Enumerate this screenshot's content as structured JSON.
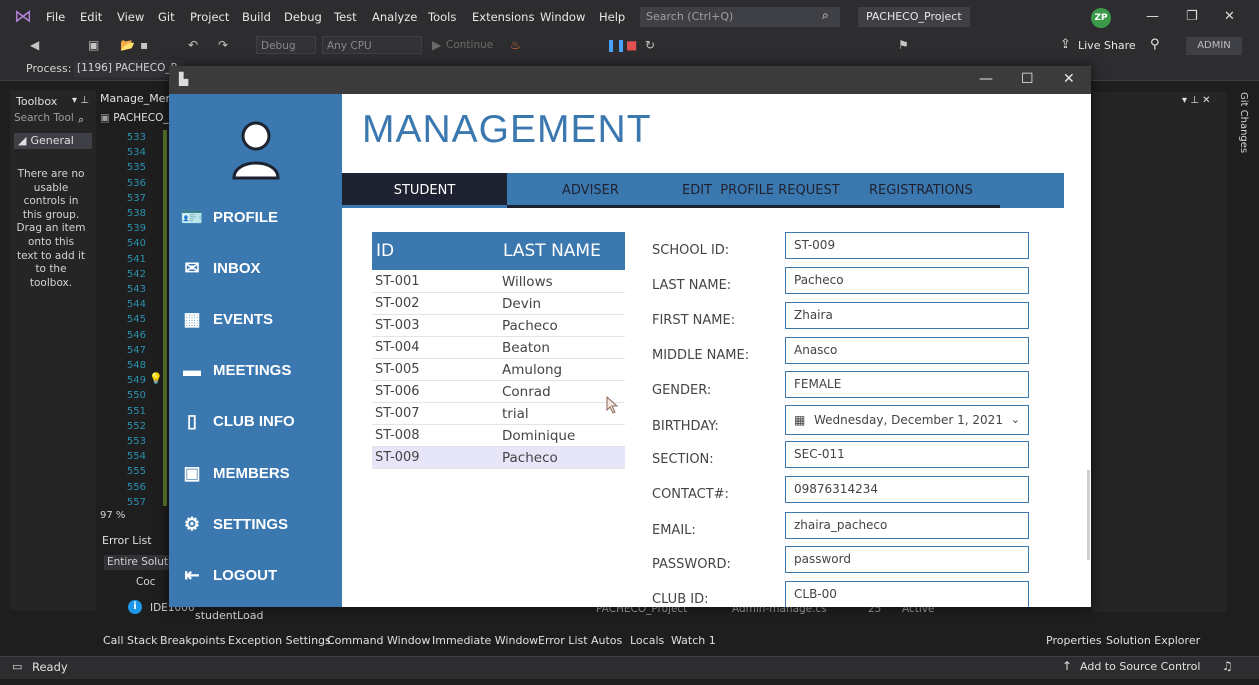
{
  "vs": {
    "menu": [
      "File",
      "Edit",
      "View",
      "Git",
      "Project",
      "Build",
      "Debug",
      "Test",
      "Analyze",
      "Tools",
      "Extensions",
      "Window",
      "Help"
    ],
    "search_placeholder": "Search (Ctrl+Q)",
    "project_name": "PACHECO_Project",
    "avatar_initials": "ZP",
    "toolbar": {
      "config": "Debug",
      "platform": "Any CPU",
      "continue": "Continue",
      "live_share": "Live Share",
      "admin": "ADMIN"
    },
    "process_label": "Process:",
    "process_value": "[1196] PACHECO_P",
    "toolbox": {
      "title": "Toolbox",
      "search_placeholder": "Search Tool",
      "group": "General",
      "empty_message": "There are no usable controls in this group. Drag an item onto this text to add it to the toolbox."
    },
    "editor_tab": "Manage_Men",
    "editor_subtab": "PACHECO_",
    "line_numbers": [
      "533",
      "534",
      "535",
      "536",
      "537",
      "538",
      "539",
      "540",
      "541",
      "542",
      "543",
      "544",
      "545",
      "546",
      "547",
      "548",
      "549",
      "550",
      "551",
      "552",
      "553",
      "554",
      "555",
      "556",
      "557"
    ],
    "zoom": "97 %",
    "error_list": {
      "title": "Error List",
      "scope": "Entire Solution",
      "code_header": "Coc",
      "code": "IDE1006",
      "text": "studentLoad",
      "project": "PACHECO_Project",
      "file": "Admin-manage.cs",
      "line": "25",
      "state": "Active"
    },
    "bottom_tabs": [
      "Call Stack",
      "Breakpoints",
      "Exception Settings",
      "Command Window",
      "Immediate Window",
      "Error List",
      "Autos",
      "Locals",
      "Watch 1"
    ],
    "right_tabs": {
      "properties": "Properties",
      "solution_explorer": "Solution Explorer",
      "git_changes": "Git Changes"
    },
    "status": {
      "ready": "Ready",
      "source_control": "Add to Source Control"
    }
  },
  "app": {
    "title": "MANAGEMENT",
    "nav": [
      {
        "label": "PROFILE",
        "icon": "profile-card-icon"
      },
      {
        "label": "INBOX",
        "icon": "envelope-icon"
      },
      {
        "label": "EVENTS",
        "icon": "calendar-icon"
      },
      {
        "label": "MEETINGS",
        "icon": "chat-icon"
      },
      {
        "label": "CLUB INFO",
        "icon": "book-icon"
      },
      {
        "label": "MEMBERS",
        "icon": "contacts-icon"
      },
      {
        "label": "SETTINGS",
        "icon": "gear-icon"
      },
      {
        "label": "LOGOUT",
        "icon": "logout-icon"
      }
    ],
    "tabs": [
      "STUDENT",
      "ADVISER",
      "EDIT  PROFILE REQUEST",
      "REGISTRATIONS"
    ],
    "table": {
      "headers": [
        "ID",
        "LAST NAME"
      ],
      "rows": [
        [
          "ST-001",
          "Willows"
        ],
        [
          "ST-002",
          "Devin"
        ],
        [
          "ST-003",
          "Pacheco"
        ],
        [
          "ST-004",
          "Beaton"
        ],
        [
          "ST-005",
          "Amulong"
        ],
        [
          "ST-006",
          "Conrad"
        ],
        [
          "ST-007",
          "trial"
        ],
        [
          "ST-008",
          "Dominique"
        ],
        [
          "ST-009",
          "Pacheco"
        ]
      ],
      "selected_index": 8
    },
    "form": {
      "school_id": {
        "label": "SCHOOL ID:",
        "value": "ST-009"
      },
      "last_name": {
        "label": "LAST NAME:",
        "value": "Pacheco"
      },
      "first_name": {
        "label": "FIRST NAME:",
        "value": "Zhaira"
      },
      "middle_name": {
        "label": "MIDDLE NAME:",
        "value": "Anasco"
      },
      "gender": {
        "label": "GENDER:",
        "value": "FEMALE"
      },
      "birthday": {
        "label": "BIRTHDAY:",
        "value": "Wednesday, December 1, 2021"
      },
      "section": {
        "label": "SECTION:",
        "value": "SEC-011"
      },
      "contact": {
        "label": "CONTACT#:",
        "value": "09876314234"
      },
      "email": {
        "label": "EMAIL:",
        "value": "zhaira_pacheco"
      },
      "password": {
        "label": "PASSWORD:",
        "value": "password"
      },
      "club_id": {
        "label": "CLUB ID:",
        "value": "CLB-00"
      }
    },
    "colors": {
      "accent": "#3c78b0",
      "dark": "#1e2230",
      "selected_row": "#e6e6f8"
    }
  }
}
